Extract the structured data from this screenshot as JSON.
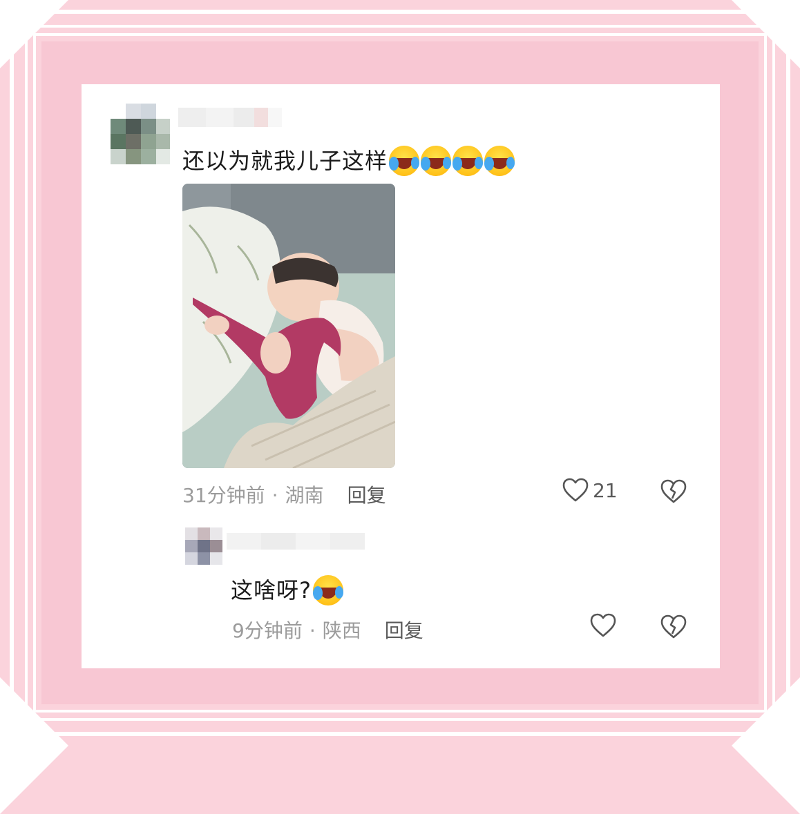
{
  "comments": [
    {
      "text": "还以为就我儿子这样",
      "emoji_count": 4,
      "emoji": "rolling-laughing-emoji",
      "time": "31分钟前",
      "location": "湖南",
      "reply_label": "回复",
      "likes": "21",
      "has_image": true,
      "image_description_icon": "photo-thumbnail"
    },
    {
      "text": "这啥呀?",
      "emoji_count": 1,
      "emoji": "rolling-laughing-emoji",
      "time": "9分钟前",
      "location": "陕西",
      "reply_label": "回复",
      "likes": ""
    }
  ],
  "separator": "·",
  "colors": {
    "frame_pink": "#f8c7d3",
    "card_bg": "#ffffff",
    "meta_gray": "#9b9b9b",
    "text_dark": "#1b1b1b",
    "potty_magenta": "#b23a64"
  }
}
